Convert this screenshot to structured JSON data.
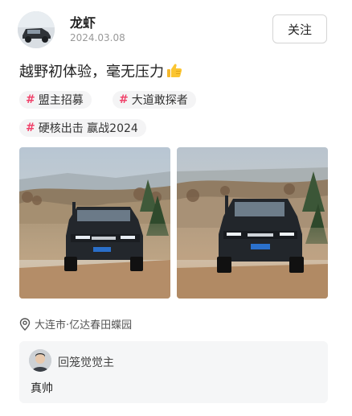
{
  "post": {
    "author": "龙虾",
    "date": "2024.03.08",
    "follow_label": "关注",
    "text": "越野初体验，毫无压力",
    "emoji": "thumbs-up-icon",
    "tags": [
      {
        "hash": "#",
        "label": "盟主招募"
      },
      {
        "hash": "#",
        "label": "大道敢探者"
      },
      {
        "hash": "#",
        "label": "硬核出击 赢战2024"
      }
    ],
    "images": [
      {
        "name": "offroad-photo-1",
        "plate": "辽B·68W"
      },
      {
        "name": "offroad-photo-2",
        "plate": "辽B·68W"
      }
    ],
    "location": "大连市·亿达春田蝶园",
    "location_icon": "location-pin-icon"
  },
  "comment": {
    "user": "回笼觉觉主",
    "text": "真帅"
  },
  "colors": {
    "tag_hash": "#f0436b",
    "tag_bg": "#f4f4f5",
    "comment_bg": "#f5f6f7",
    "date": "#999999"
  }
}
